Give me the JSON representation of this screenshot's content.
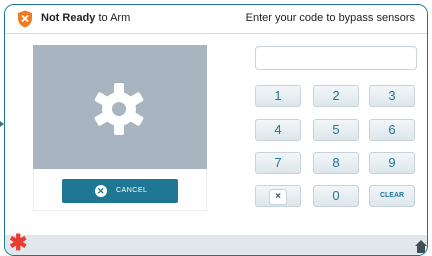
{
  "header": {
    "status_bold": "Not Ready",
    "status_rest": " to Arm",
    "instruction": "Enter your code to bypass sensors",
    "warning_icon": "shield-x-icon",
    "warning_color": "#f07c22"
  },
  "camera": {
    "placeholder_icon": "gear-icon",
    "cancel_label": "CANCEL",
    "cancel_icon": "x-circle-icon"
  },
  "keypad": {
    "code_value": "",
    "keys": [
      "1",
      "2",
      "3",
      "4",
      "5",
      "6",
      "7",
      "8",
      "9",
      "×",
      "0",
      "CLEAR"
    ],
    "delete_icon": "delete-icon"
  },
  "footer": {
    "left_icon": "asterisk-icon",
    "right_icon": "home-icon",
    "asterisk_color": "#e83c2f"
  },
  "colors": {
    "accent": "#1e7893",
    "panel_border": "#1e7893",
    "placeholder_bg": "#a8b5c0",
    "footer_bg": "#e2e7eb"
  }
}
